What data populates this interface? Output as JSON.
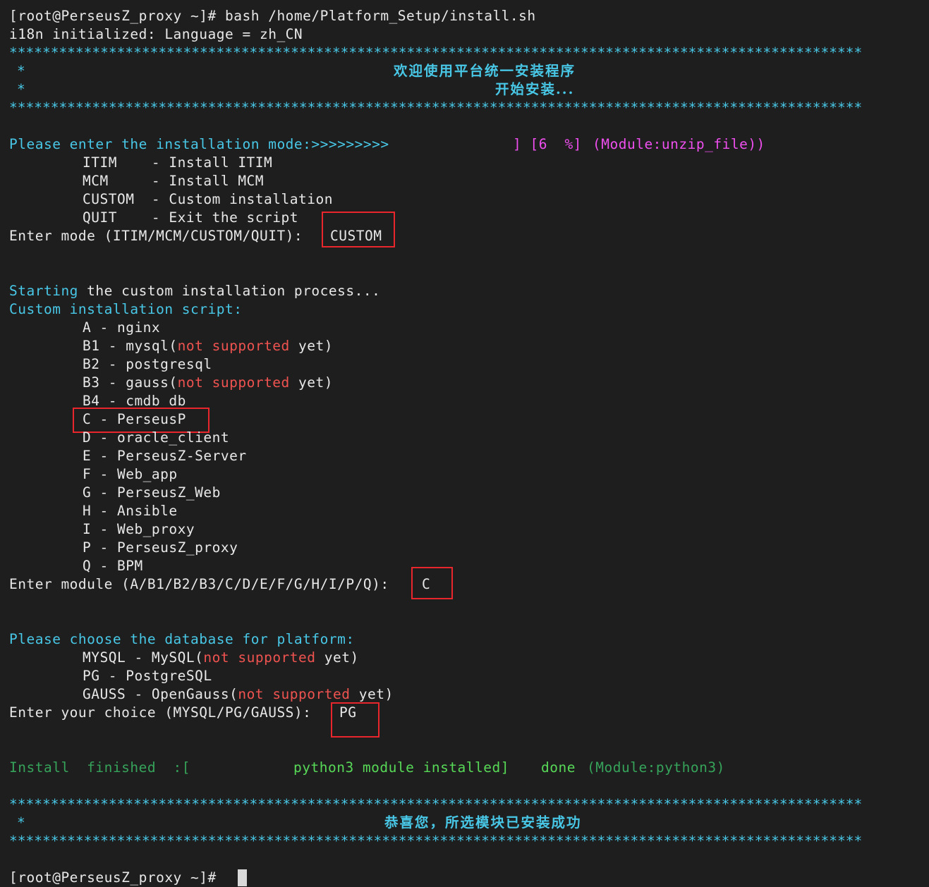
{
  "terminal": {
    "prompt1": "[root@PerseusZ_proxy ~]# bash /home/Platform_Setup/install.sh",
    "i18n_line": "i18n initialized: Language = zh_CN",
    "stars": "*******************************************************************************************************",
    "banner_star": "*",
    "banner_welcome": "欢迎使用平台统一安装程序",
    "banner_start": "开始安装...",
    "mode_prompt": "Please enter the installation mode:>>>>>>>>>",
    "progress_bracket": "] [6  %]",
    "progress_module": "(Module:unzip_file))",
    "modes": [
      "ITIM    - Install ITIM",
      "MCM     - Install MCM",
      "CUSTOM  - Custom installation",
      "QUIT    - Exit the script"
    ],
    "enter_mode_label": "Enter mode (ITIM/MCM/CUSTOM/QUIT):",
    "enter_mode_value": "CUSTOM",
    "starting_word": "Starting",
    "starting_rest": " the custom installation process...",
    "custom_script": "Custom installation script:",
    "modules": {
      "a": "A - nginx",
      "b1_pre": "B1 - mysql(",
      "b1_not": "not",
      "b1_sup": "supported",
      "b1_post": " yet)",
      "b2": "B2 - postgresql",
      "b3_pre": "B3 - gauss(",
      "b3_not": "not",
      "b3_sup": "supported",
      "b3_post": " yet)",
      "b4": "B4 - cmdb_db",
      "c": "C - PerseusP",
      "d": "D - oracle_client",
      "e": "E - PerseusZ-Server",
      "f": "F - Web_app",
      "g": "G - PerseusZ_Web",
      "h": "H - Ansible",
      "i": "I - Web_proxy",
      "p": "P - PerseusZ_proxy",
      "q": "Q - BPM"
    },
    "enter_module_label": "Enter module (A/B1/B2/B3/C/D/E/F/G/H/I/P/Q):",
    "enter_module_value": "C",
    "db_prompt": "Please choose the database for platform:",
    "db": {
      "mysql_pre": "MYSQL - MySQL(",
      "mysql_not": "not",
      "mysql_sup": "supported",
      "mysql_post": " yet)",
      "pg": "PG - PostgreSQL",
      "gauss_pre": "GAUSS - OpenGauss(",
      "gauss_not": "not",
      "gauss_sup": "supported",
      "gauss_post": " yet)"
    },
    "enter_choice_label": "Enter your choice (MYSQL/PG/GAUSS):",
    "enter_choice_value": "PG",
    "install_finished": "Install  finished  :[",
    "python_installed": "python3 module installed]",
    "done": "done",
    "python_module": "(Module:python3)",
    "success_msg": "恭喜您，所选模块已安装成功",
    "prompt2": "[root@PerseusZ_proxy ~]#"
  },
  "colors": {
    "background": "#1e1e1e",
    "text": "#e8e8e8",
    "cyan": "#48c7e6",
    "red": "#ef5350",
    "magenta": "#ee4fee",
    "green": "#57d957",
    "highlight_box": "#e8262b"
  }
}
